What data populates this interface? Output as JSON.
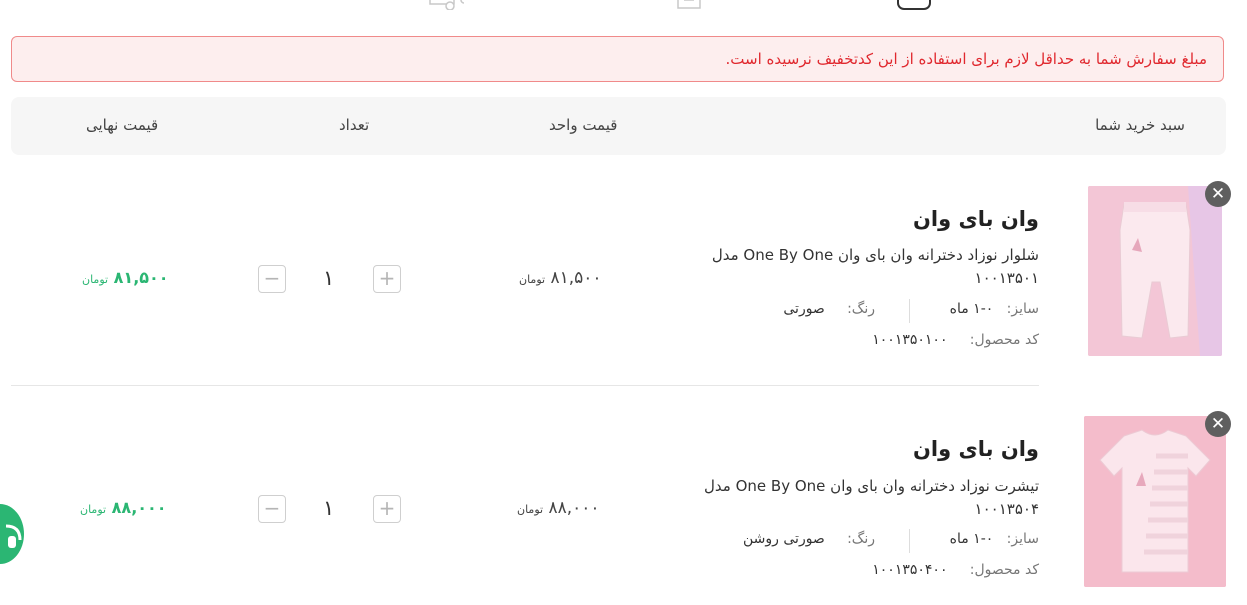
{
  "alert": {
    "message": "مبلغ سفارش شما به حداقل لازم برای استفاده از این کدتخفیف نرسیده است."
  },
  "table_header": {
    "cart": "سبد خرید شما",
    "unit_price": "قیمت واحد",
    "quantity": "تعداد",
    "final_price": "قیمت نهایی"
  },
  "items": [
    {
      "brand": "وان بای وان",
      "name": "شلوار نوزاد دخترانه وان بای وان One By One مدل ۱۰۰۱۳۵۰۱",
      "size_label": "سایز:",
      "size_value": "۰-۱ ماه",
      "color_label": "رنگ:",
      "color_value": "صورتی",
      "code_label": "کد محصول:",
      "code_value": "۱۰۰۱۳۵۰۱۰۰",
      "unit_price": "۸۱,۵۰۰",
      "currency": "تومان",
      "quantity": "۱",
      "final_price": "۸۱,۵۰۰",
      "image_color": "#f3c5d6"
    },
    {
      "brand": "وان بای وان",
      "name": "تیشرت نوزاد دخترانه وان بای وان One By One مدل ۱۰۰۱۳۵۰۴",
      "size_label": "سایز:",
      "size_value": "۰-۱ ماه",
      "color_label": "رنگ:",
      "color_value": "صورتی روشن",
      "code_label": "کد محصول:",
      "code_value": "۱۰۰۱۳۵۰۴۰۰",
      "unit_price": "۸۸,۰۰۰",
      "currency": "تومان",
      "quantity": "۱",
      "final_price": "۸۸,۰۰۰",
      "image_color": "#f4bccb"
    }
  ],
  "buttons": {
    "plus": "+",
    "minus": "−",
    "remove": "✕"
  },
  "colors": {
    "accent_green": "#2bb673",
    "alert_red": "#e0282e",
    "alert_bg": "#fdeeee"
  }
}
